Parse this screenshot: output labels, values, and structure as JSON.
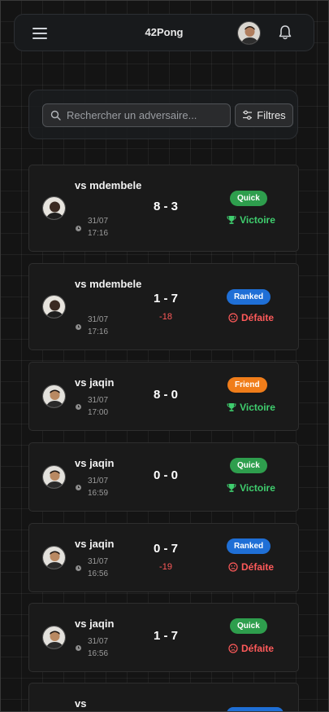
{
  "header": {
    "title": "42Pong",
    "menu_icon": "hamburger-menu-icon",
    "notification_icon": "bell-icon"
  },
  "search": {
    "placeholder": "Rechercher un adversaire...",
    "value": "",
    "filters_label": "Filtres"
  },
  "colors": {
    "quick": "#2e9e4d",
    "ranked": "#1f6fd6",
    "friend": "#f07d1a",
    "victory": "#3fce6e",
    "defeat": "#ff5a5a"
  },
  "matches": [
    {
      "opponent": "vs mdembele",
      "date": "31/07",
      "time": "17:16",
      "score": "8 - 3",
      "delta": "",
      "mode": "Quick",
      "result": "Victoire"
    },
    {
      "opponent": "vs mdembele",
      "date": "31/07",
      "time": "17:16",
      "score": "1 - 7",
      "delta": "-18",
      "mode": "Ranked",
      "result": "Défaite"
    },
    {
      "opponent": "vs jaqin",
      "date": "31/07",
      "time": "17:00",
      "score": "8 - 0",
      "delta": "",
      "mode": "Friend",
      "result": "Victoire"
    },
    {
      "opponent": "vs jaqin",
      "date": "31/07",
      "time": "16:59",
      "score": "0 - 0",
      "delta": "",
      "mode": "Quick",
      "result": "Victoire"
    },
    {
      "opponent": "vs jaqin",
      "date": "31/07",
      "time": "16:56",
      "score": "0 - 7",
      "delta": "-19",
      "mode": "Ranked",
      "result": "Défaite"
    },
    {
      "opponent": "vs jaqin",
      "date": "31/07",
      "time": "16:56",
      "score": "1 - 7",
      "delta": "",
      "mode": "Quick",
      "result": "Défaite"
    },
    {
      "opponent": "vs"
    }
  ]
}
